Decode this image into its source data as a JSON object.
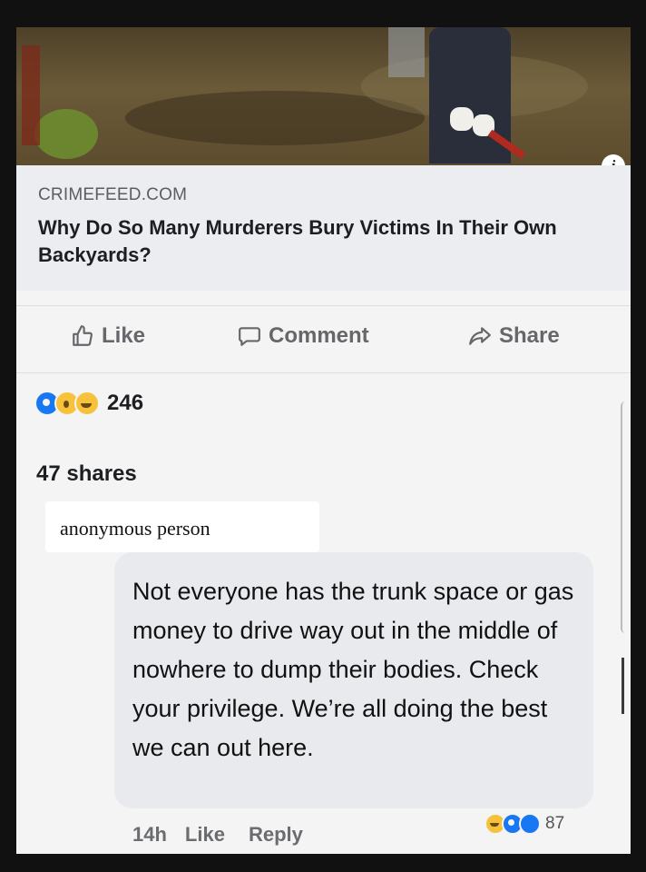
{
  "link_preview": {
    "domain": "CRIMEFEED.COM",
    "headline": "Why Do So Many Murderers Bury Victims In Their Own Backyards?",
    "info_icon": "info-icon",
    "info_glyph": "i"
  },
  "actions": {
    "like_label": "Like",
    "comment_label": "Comment",
    "share_label": "Share"
  },
  "post_stats": {
    "reaction_icons": [
      "like-reaction-icon",
      "wow-reaction-icon",
      "haha-reaction-icon"
    ],
    "reaction_count": "246",
    "shares": "47 shares"
  },
  "comment": {
    "author": "anonymous person",
    "text": "Not everyone has the trunk space or gas money to drive way out in the middle of nowhere to dump their bodies. Check your privilege. We’re all doing the best we can out here.",
    "time": "14h",
    "like_label": "Like",
    "reply_label": "Reply",
    "reaction_count": "87"
  },
  "colors": {
    "like_blue": "#1877f2",
    "reaction_yellow": "#f7c23b",
    "muted_text": "#65676b"
  }
}
